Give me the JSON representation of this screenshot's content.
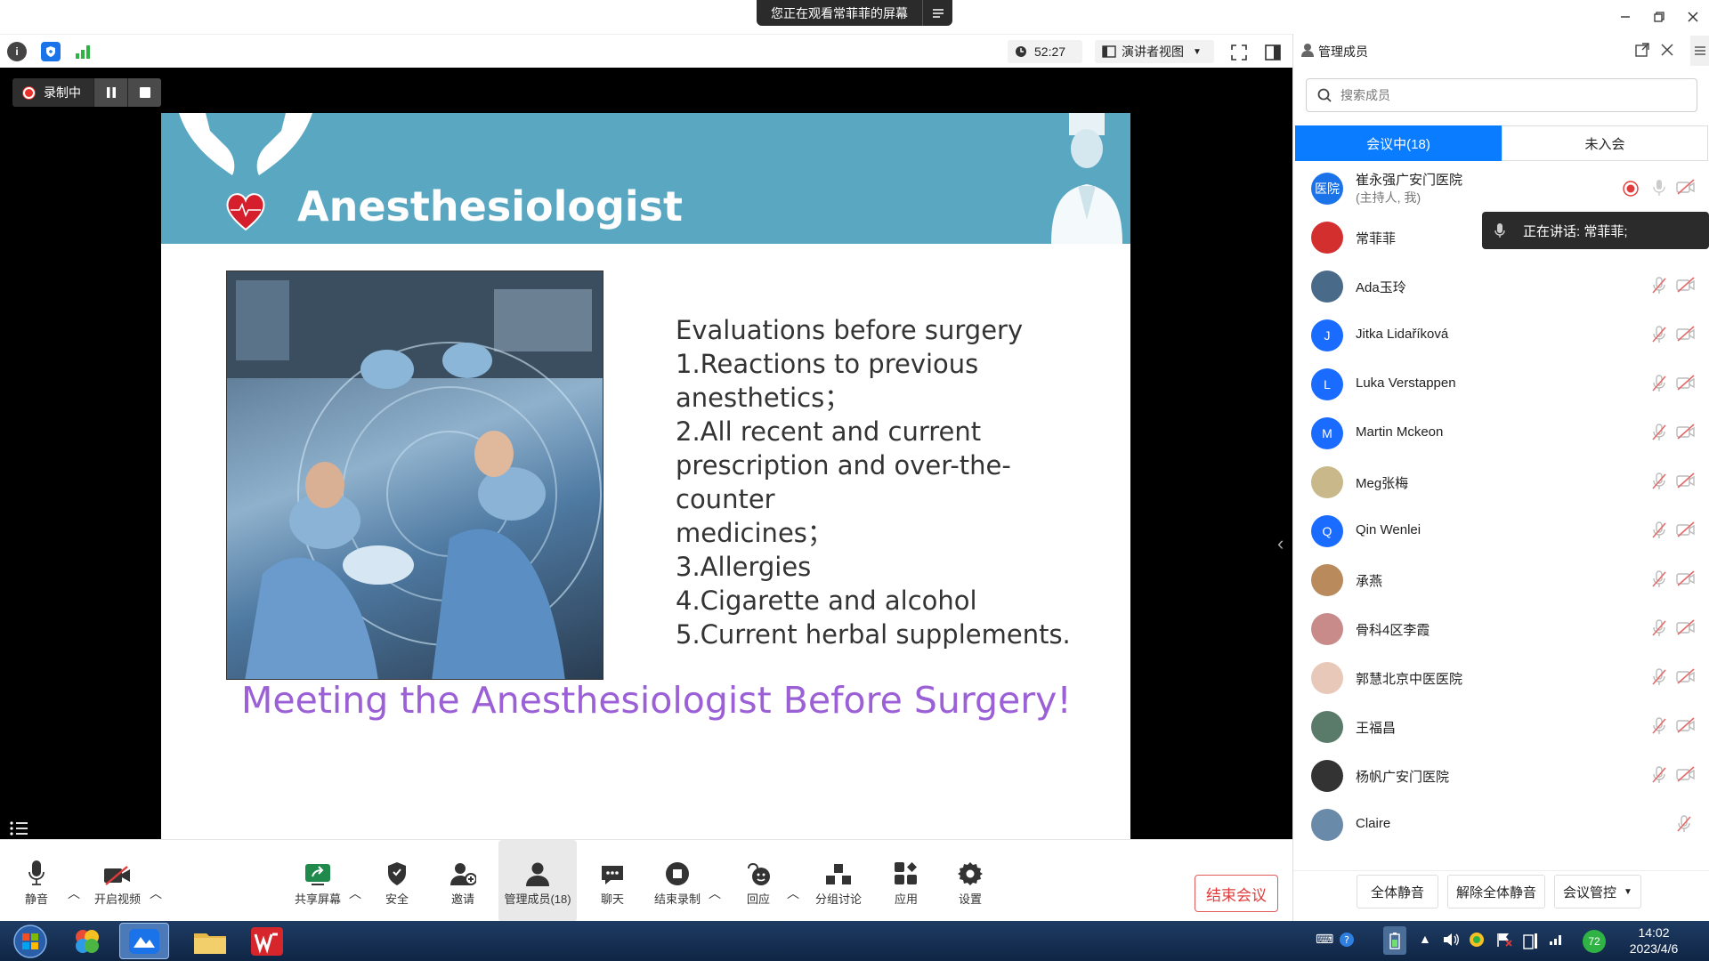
{
  "titlebar": {
    "share_banner": "您正在观看常菲菲的屏幕",
    "menu_glyph": "≡"
  },
  "topbar": {
    "timer": "52:27",
    "view_mode": "演讲者视图"
  },
  "recording": {
    "label": "录制中"
  },
  "slide": {
    "title": "Anesthesiologist",
    "lines": [
      "Evaluations before surgery",
      "1.Reactions to previous",
      "anesthetics；",
      "2.All recent and current",
      "prescription and over-the-counter",
      "medicines；",
      "3.Allergies",
      "4.Cigarette  and  alcohol",
      "5.Current herbal supplements."
    ],
    "tagline": "Meeting the Anesthesiologist Before Surgery!"
  },
  "bottombar": {
    "mute": "静音",
    "video": "开启视频",
    "share": "共享屏幕",
    "security": "安全",
    "invite": "邀请",
    "members": "管理成员(18)",
    "chat": "聊天",
    "end_record": "结束录制",
    "reactions": "回应",
    "breakout": "分组讨论",
    "apps": "应用",
    "settings": "设置",
    "end_meeting": "结束会议"
  },
  "panel": {
    "title": "管理成员",
    "search_placeholder": "搜索成员",
    "tab_in": "会议中(18)",
    "tab_out": "未入会",
    "speaking": "正在讲话: 常菲菲;",
    "members": [
      {
        "name": "崔永强广安门医院",
        "sub": "(主持人, 我)",
        "avatar": "医院",
        "color": "#1a73e8"
      },
      {
        "name": "常菲菲",
        "avatar": "",
        "color": "#d32f2f"
      },
      {
        "name": "Ada玉玲",
        "avatar": "",
        "color": "#4a6a8a"
      },
      {
        "name": "Jitka Lidaříková",
        "avatar": "J",
        "color": "#1a6bff"
      },
      {
        "name": "Luka Verstappen",
        "avatar": "L",
        "color": "#1a6bff"
      },
      {
        "name": "Martin Mckeon",
        "avatar": "M",
        "color": "#1a6bff"
      },
      {
        "name": "Meg张梅",
        "avatar": "",
        "color": "#c9b98a"
      },
      {
        "name": "Qin Wenlei",
        "avatar": "Q",
        "color": "#1a6bff"
      },
      {
        "name": "承燕",
        "avatar": "",
        "color": "#b88a5c"
      },
      {
        "name": "骨科4区李霞",
        "avatar": "",
        "color": "#c98a8a"
      },
      {
        "name": "郭慧北京中医医院",
        "avatar": "",
        "color": "#e8c8b8"
      },
      {
        "name": "王福昌",
        "avatar": "",
        "color": "#5a7a6a"
      },
      {
        "name": "杨帆广安门医院",
        "avatar": "",
        "color": "#333333"
      },
      {
        "name": "Claire",
        "avatar": "",
        "color": "#6a8aaa"
      }
    ],
    "footer": {
      "mute_all": "全体静音",
      "unmute_all": "解除全体静音",
      "controls": "会议管控"
    }
  },
  "taskbar": {
    "time": "14:02",
    "date": "2023/4/6",
    "badge": "72"
  }
}
